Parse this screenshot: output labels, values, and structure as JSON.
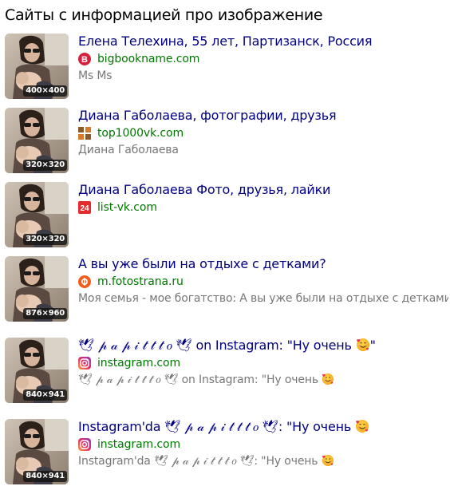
{
  "page": {
    "heading": "Сайты с информацией про изображение"
  },
  "results": [
    {
      "thumb_size": "400×400",
      "title": "Елена Телехина, 55 лет, Партизанск, Россия",
      "favicon": "bigbookname-icon",
      "domain": "bigbookname.com",
      "snippet": "Ms Ms"
    },
    {
      "thumb_size": "320×320",
      "title": "Диана Габолаева, фотографии, друзья",
      "favicon": "top1000vk-icon",
      "domain": "top1000vk.com",
      "snippet": "Диана Габолаева"
    },
    {
      "thumb_size": "320×320",
      "title": "Диана Габолаева Фото, друзья, лайки",
      "favicon": "list-vk-24-icon",
      "domain": "list-vk.com",
      "snippet": ""
    },
    {
      "thumb_size": "876×960",
      "title": "А вы уже были на отдыхе с детками?",
      "favicon": "fotostrana-icon",
      "domain": "m.fotostrana.ru",
      "snippet": "Моя семья - мое богатство: А вы уже были на отдыхе с детками?"
    },
    {
      "thumb_size": "840×941",
      "title_parts": [
        "🕊 𝓅 𝒶 𝓅 𝒾 𝓉 𝓉 𝓉 𝑜 🕊 on Instagram: \"Ну очень ",
        "\""
      ],
      "favicon": "instagram-icon",
      "domain": "instagram.com",
      "snippet_parts": [
        "🕊 𝓅 𝒶 𝓅 𝒾 𝓉 𝓉 𝓉 𝑜 🕊 on Instagram: \"Ну очень ",
        ""
      ]
    },
    {
      "thumb_size": "840×941",
      "title_parts": [
        "Instagram'da 🕊 𝓅 𝒶 𝓅 𝒾 𝓉 𝓉 𝓉 𝑜 🕊: \"Ну очень ",
        ""
      ],
      "favicon": "instagram-icon",
      "domain": "instagram.com",
      "snippet_parts": [
        "Instagram'da 🕊 𝓅 𝒶 𝓅 𝒾 𝓉 𝓉 𝓉 𝑜 🕊: \"Ну очень ",
        ""
      ]
    }
  ],
  "emoji": "smiling-face-with-hearts-icon",
  "colors": {
    "title_link": "#000080",
    "domain": "#007700",
    "snippet": "#777777",
    "bigbookname": "#d6213d",
    "fotostrana": "#f25d1c",
    "list_vk": "#e52b2b",
    "instagram_start": "#f9a03f",
    "instagram_end": "#8a3ab9"
  }
}
